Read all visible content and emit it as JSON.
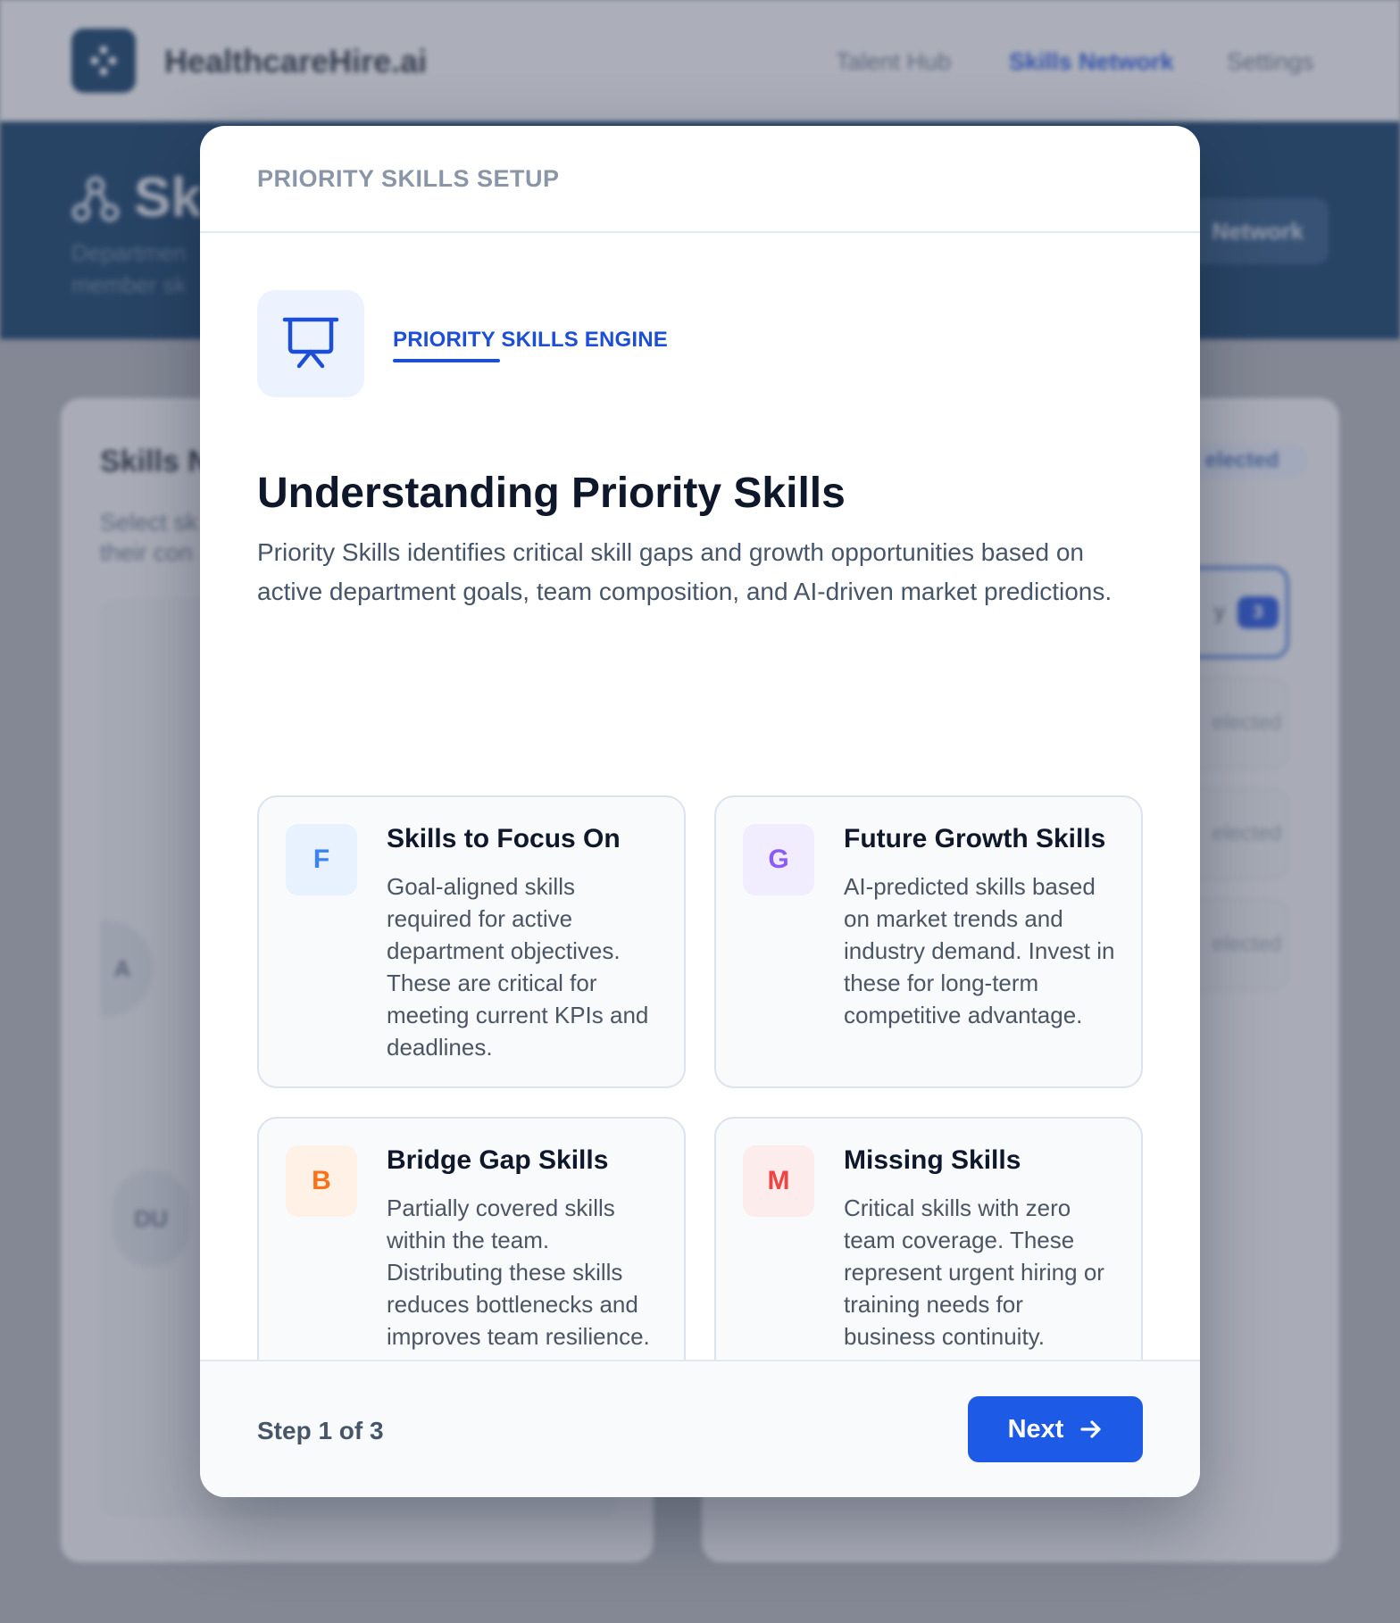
{
  "background": {
    "brand": "HealthcareHire.ai",
    "nav": [
      "Talent Hub",
      "Skills Network",
      "Settings"
    ],
    "active_nav": "Skills Network",
    "hero_title": "Sk",
    "hero_sub_1": "Departmen",
    "hero_sub_2": "member sk",
    "hero_button": "Network",
    "panel_title": "Skills N",
    "panel_sub_1": "Select sk",
    "panel_sub_2": "their con",
    "avatars": [
      "A",
      "DU"
    ],
    "selected_badge": "elected",
    "rows": [
      {
        "label": "y",
        "count": "3"
      },
      {
        "label": "elected"
      },
      {
        "label": "elected"
      },
      {
        "label": "elected"
      }
    ]
  },
  "modal": {
    "header_title": "PRIORITY SKILLS SETUP",
    "engine_icon": "presentation-board-icon",
    "engine_label": "PRIORITY SKILLS ENGINE",
    "title": "Understanding Priority Skills",
    "description": "Priority Skills identifies critical skill gaps and growth opportunities based on active department goals, team composition, and AI-driven market predictions.",
    "cards": [
      {
        "letter": "F",
        "title": "Skills to Focus On",
        "description": "Goal-aligned skills required for active department objectives. These are critical for meeting current KPIs and deadlines.",
        "color": "#3b82f6",
        "bg": "#e8f1fe"
      },
      {
        "letter": "G",
        "title": "Future Growth Skills",
        "description": "AI-predicted skills based on market trends and industry demand. Invest in these for long-term competitive advantage.",
        "color": "#8b5cf6",
        "bg": "#f1edfe"
      },
      {
        "letter": "B",
        "title": "Bridge Gap Skills",
        "description": "Partially covered skills within the team. Distributing these skills reduces bottlenecks and improves team resilience.",
        "color": "#f97316",
        "bg": "#fff1e6"
      },
      {
        "letter": "M",
        "title": "Missing Skills",
        "description": "Critical skills with zero team coverage. These represent urgent hiring or training needs for business continuity.",
        "color": "#ef4444",
        "bg": "#fdecec"
      }
    ],
    "step_text": "Step 1 of 3",
    "next_label": "Next"
  }
}
